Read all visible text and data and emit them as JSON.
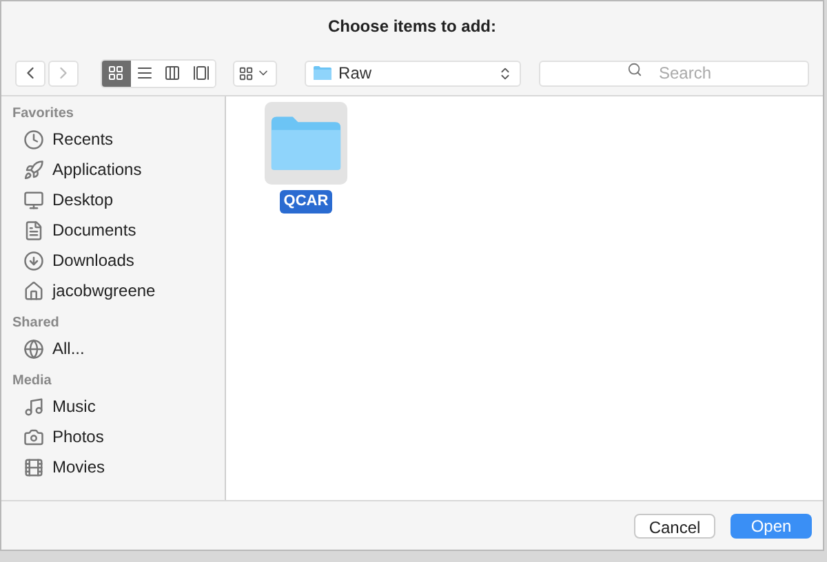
{
  "window": {
    "title": "Choose items to add:"
  },
  "toolbar": {
    "view_modes": [
      {
        "kind": "icons",
        "selected": true
      },
      {
        "kind": "list",
        "selected": false
      },
      {
        "kind": "columns",
        "selected": false
      },
      {
        "kind": "coverflow",
        "selected": false
      }
    ],
    "location": "Raw",
    "search": {
      "placeholder": "Search"
    }
  },
  "sidebar": [
    {
      "heading": "Favorites",
      "items": [
        {
          "kind": "recents",
          "label": "Recents"
        },
        {
          "kind": "applications",
          "label": "Applications"
        },
        {
          "kind": "desktop",
          "label": "Desktop"
        },
        {
          "kind": "documents",
          "label": "Documents"
        },
        {
          "kind": "downloads",
          "label": "Downloads"
        },
        {
          "kind": "home",
          "label": "jacobwgreene"
        }
      ]
    },
    {
      "heading": "Shared",
      "items": [
        {
          "kind": "network",
          "label": "All..."
        }
      ]
    },
    {
      "heading": "Media",
      "items": [
        {
          "kind": "music",
          "label": "Music"
        },
        {
          "kind": "photos",
          "label": "Photos"
        },
        {
          "kind": "movies",
          "label": "Movies"
        }
      ]
    }
  ],
  "files": [
    {
      "name": "QCAR",
      "selected": true
    }
  ],
  "buttons": [
    {
      "label": "Cancel",
      "kind": "secondary"
    },
    {
      "label": "Open",
      "kind": "primary"
    }
  ]
}
